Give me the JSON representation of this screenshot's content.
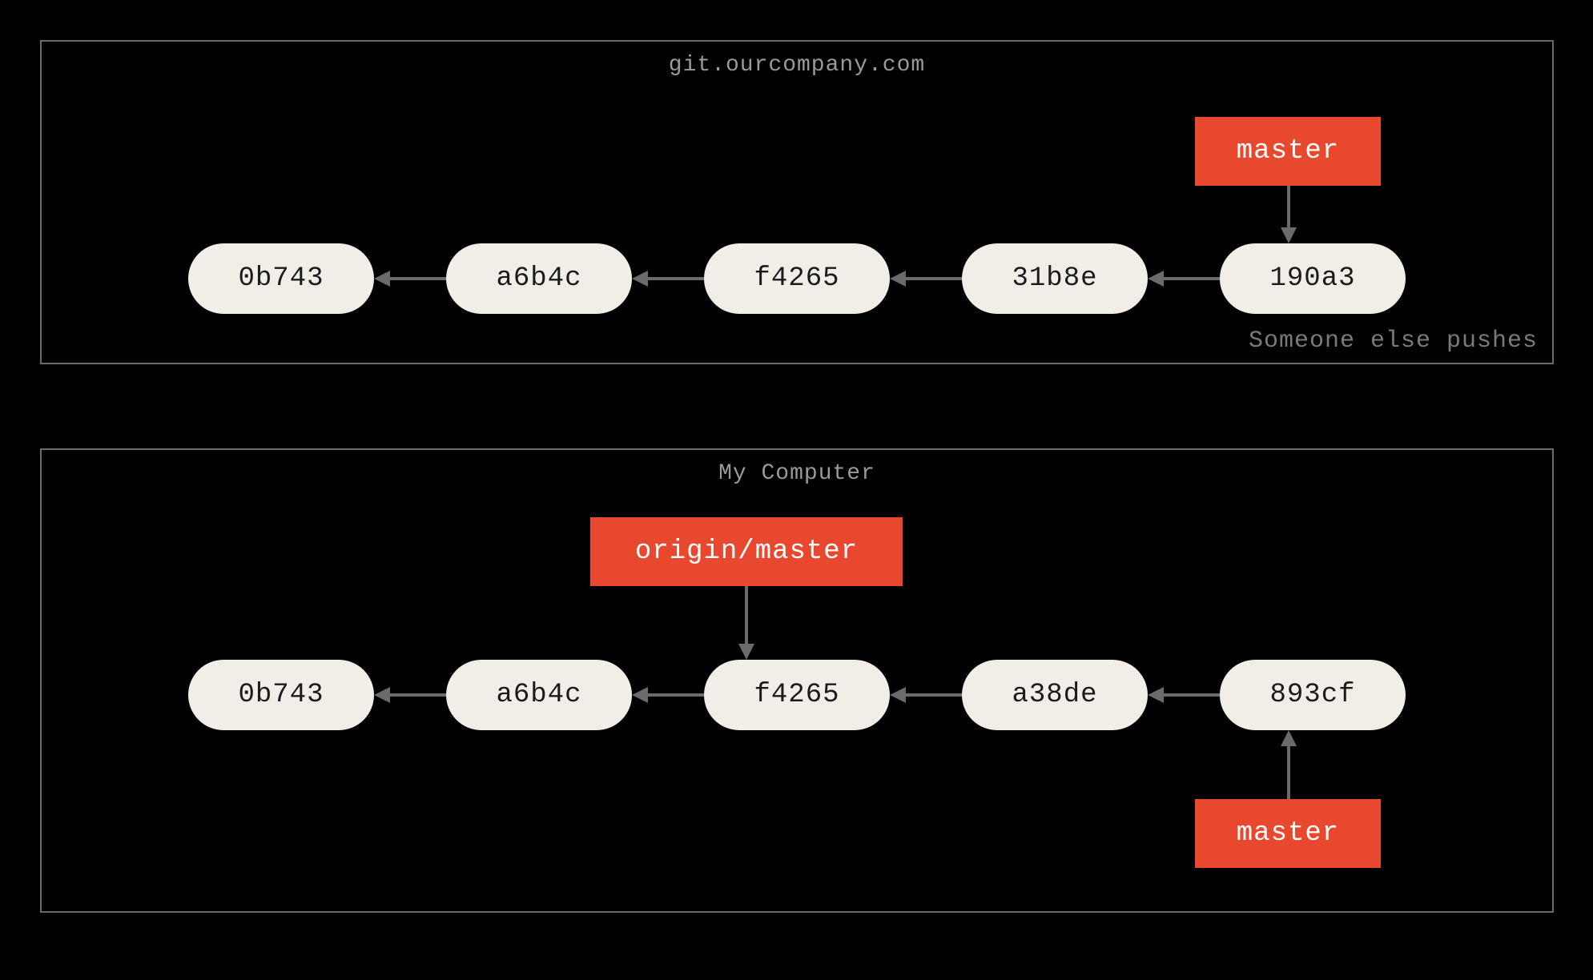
{
  "top_panel": {
    "title": "git.ourcompany.com",
    "push_note": "Someone else pushes",
    "commits": [
      "0b743",
      "a6b4c",
      "f4265",
      "31b8e",
      "190a3"
    ],
    "ref_master": "master"
  },
  "bottom_panel": {
    "title": "My Computer",
    "commits": [
      "0b743",
      "a6b4c",
      "f4265",
      "a38de",
      "893cf"
    ],
    "ref_origin_master": "origin/master",
    "ref_master": "master"
  },
  "colors": {
    "bg": "#000000",
    "border": "#6b6b6b",
    "commit_bg": "#f0eee6",
    "commit_fg": "#1b1b1b",
    "ref_bg": "#e8492e",
    "ref_fg": "#ffffff",
    "title_fg": "#9a9a9a",
    "note_fg": "#7a7a7a",
    "arrow": "#6b6b6b"
  }
}
